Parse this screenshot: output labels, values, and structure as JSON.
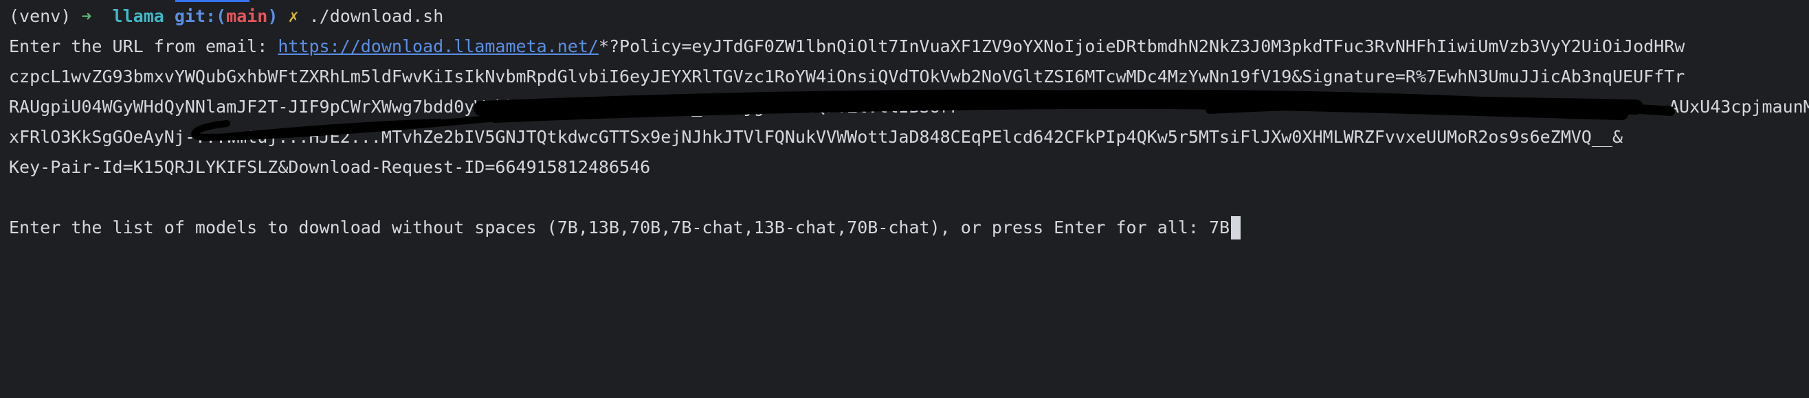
{
  "prompt": {
    "venv": "(venv)",
    "arrow": "➜",
    "directory": "llama",
    "git_label": "git:(",
    "branch": "main",
    "git_close": ")",
    "dirty_marker": "✗",
    "command": "./download.sh"
  },
  "url_prompt": {
    "label": "Enter the URL from email: ",
    "link_text": "https://download.llamameta.net/",
    "line1_rest": "*?Policy=eyJTdGF0ZW1lbnQiOlt7InVuaXF1ZV9oYXNoIjoieDRtbmdhN2NkZ3J0M3pkdTFuc3RvNHFhIiwiUmVzb3VyY2UiOiJodHRw",
    "line2": "czpcL1wvZG93bmxvYWQubGxhbWFtZXRhLm5ldFwvKiIsIkNvbmRpdGlvbiI6eyJEYXRlTGVzc1RoYW4iOnsiQVdTOkVwb2NoVGltZSI6MTcwMDc4MzYwNn19fV19&Signature=R%7EwhN3UmuJJicAb3nqUEUFfTr",
    "line3": "RAUgpiU04WGyWHdQyNNlamJF2T-JIF9pCWrXWwg7bdd0yWrhh%7EwAmR0OualCTkjV_0e7ejgY6O-cQPYZlVtlIBSUrF",
    "line4": "xFRlO3KkSgGOeAyNj-...wmtuj...HJE2...MTvhZe2bIV5GNJTQtkdwcGTTSx9ejNJhkJTVlFQNukVVWWottJaD848CEqPElcd642CFkPIp4QKw5r5MTsiFlJXw0XHMLWRZFvvxeUUMoR2os9s6eZMVQ__&",
    "line4_tail": "AUxU43cpjmaunM",
    "line5": "Key-Pair-Id=K15QRJLYKIFSLZ&Download-Request-ID=664915812486546"
  },
  "models_prompt": {
    "label": "Enter the list of models to download without spaces (7B,13B,70B,7B-chat,13B-chat,70B-chat), or press Enter for all: ",
    "input_value": "7B"
  },
  "colors": {
    "background": "#1e1f22",
    "text": "#d4d7de",
    "arrow": "#5fb573",
    "directory": "#41b8c8",
    "git": "#5a8fe6",
    "branch": "#e5565c",
    "dirty": "#d8b73c",
    "link": "#5a8fe6",
    "accent": "#3574f0",
    "redaction": "#000000"
  },
  "redaction": {
    "description_icon": "scribble-redaction"
  }
}
